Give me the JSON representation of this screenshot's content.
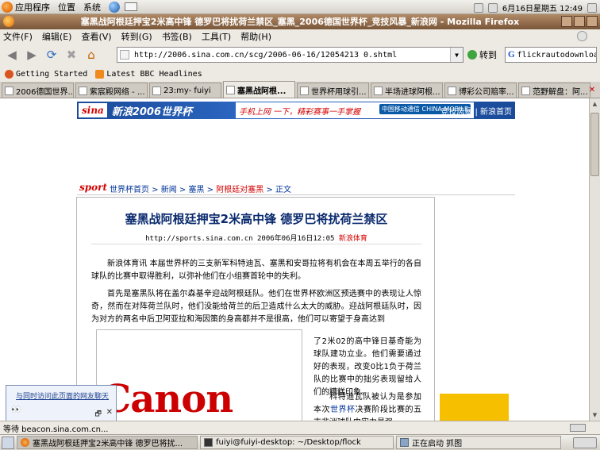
{
  "top_panel": {
    "menus": [
      "应用程序",
      "位置",
      "系统"
    ],
    "clock": "6月16日星期五 12:49"
  },
  "window": {
    "title": "塞黑战阿根廷押宝2米高中锋 德罗巴将扰荷兰禁区_塞黑_2006德国世界杯_竞技风暴_新浪网 - Mozilla Firefox"
  },
  "menubar": [
    "文件(F)",
    "编辑(E)",
    "查看(V)",
    "转到(G)",
    "书签(B)",
    "工具(T)",
    "帮助(H)"
  ],
  "navbar": {
    "url": "http://2006.sina.com.cn/scg/2006-06-16/12054213 0.shtml",
    "go_label": "转到",
    "search_value": "flickrautodownloadr",
    "search_engine": "G"
  },
  "bookmarks": [
    "Getting Started",
    "Latest BBC Headlines"
  ],
  "tabs": [
    {
      "label": "2006德国世界..."
    },
    {
      "label": "紫宸殿网络 - ..."
    },
    {
      "label": "23:my- fuiyi"
    },
    {
      "label": "塞黑战阿根..."
    },
    {
      "label": "世界杯用球引..."
    },
    {
      "label": "半场进球阿根..."
    },
    {
      "label": "博彩公司赔率..."
    },
    {
      "label": "范野解盘：阿..."
    }
  ],
  "page": {
    "banner": {
      "sina": "sina",
      "worldcup": "新浪2006世界杯",
      "ad_text": "手机上网 一下，精彩赛事一手掌握",
      "ad_brand": "中国移动通信 CHINA MOBILE",
      "links": "竞技风暴 | 新浪首页"
    },
    "sport_logo": "sport",
    "breadcrumb": [
      "世界杯首页",
      "新闻",
      "塞黑"
    ],
    "breadcrumb_current": "阿根廷对塞黑",
    "breadcrumb_last": "正文",
    "headline": "塞黑战阿根廷押宝2米高中锋 德罗巴将扰荷兰禁区",
    "meta_url": "http://sports.sina.com.cn 2006年06月16日12:05",
    "meta_source": "新浪体育",
    "p1": "新浪体育讯 本届世界杯的三支新军科特迪瓦、塞黑和安哥拉将有机会在本周五举行的各自球队的比赛中取得胜利，以弥补他们在小组赛首轮中的失利。",
    "p2": "首先是塞黑队将在盖尔森基辛迎战阿根廷队。他们在世界杯欧洲区预选赛中的表现让人惊奇，然而在对阵荷兰队时，他们没能给荷兰的后卫造成什么太大的威胁。迎战阿根廷队时，因为对方的两名中后卫阿亚拉和海因策的身高都并不是很高，他们可以寄望于身高达到",
    "p2b": "了2米02的高中锋日基奇能为球队建功立业。他们需要通过好的表现，改变0比1负于荷兰队的比赛中的拙劣表现留给人们的糟糕印象。",
    "p3_pre": "科特迪瓦队被认为是参加本次",
    "p3_link": "世界杯",
    "p3_post": "决赛阶段比赛的五支非洲球队中实力最强",
    "ad_brand": "Canon",
    "chat_link": "与同时访问此页面的网友聊天",
    "chat_face": "👀"
  },
  "statusbar": {
    "text": "等待 beacon.sina.com.cn..."
  },
  "taskbar": [
    {
      "label": "塞黑战阿根廷押宝2米高中锋 德罗巴将扰...",
      "active": true
    },
    {
      "label": "fuiyi@fuiyi-desktop: ~/Desktop/flock",
      "active": false
    },
    {
      "label": "正在启动 抓图",
      "active": false
    }
  ]
}
